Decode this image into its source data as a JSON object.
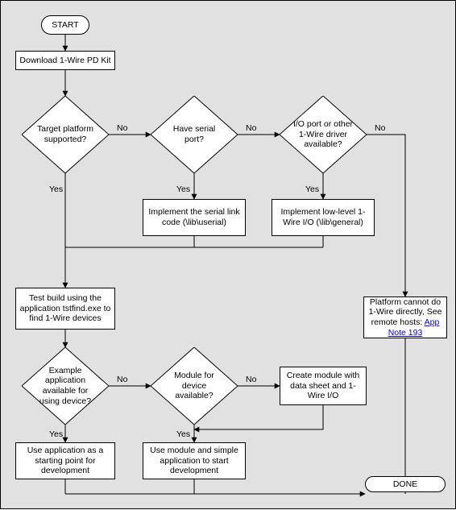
{
  "chart_data": {
    "type": "flowchart",
    "title": "",
    "nodes": [
      {
        "id": "start",
        "kind": "terminator",
        "text": "START"
      },
      {
        "id": "download",
        "kind": "process",
        "text": "Download 1-Wire PD Kit"
      },
      {
        "id": "d_target",
        "kind": "decision",
        "text": "Target platform supported?"
      },
      {
        "id": "d_serial",
        "kind": "decision",
        "text": "Have serial port?"
      },
      {
        "id": "d_ioport",
        "kind": "decision",
        "text": "I/O port or other 1-Wire driver available?"
      },
      {
        "id": "p_serial",
        "kind": "process",
        "text": "Implement the serial link code (\\lib\\userial)"
      },
      {
        "id": "p_lowlvl",
        "kind": "process",
        "text": "Implement low-level 1-Wire I/O (\\lib\\general)"
      },
      {
        "id": "p_test",
        "kind": "process",
        "text": "Test build using the application tstfind.exe to find 1-Wire devices"
      },
      {
        "id": "p_remote",
        "kind": "process",
        "text_before_link": "Platform cannot do 1-Wire directly, See remote hosts: ",
        "link_text": "App Note 193"
      },
      {
        "id": "d_example",
        "kind": "decision",
        "text": "Example application available for using device?"
      },
      {
        "id": "d_module",
        "kind": "decision",
        "text": "Module for device available?"
      },
      {
        "id": "p_create",
        "kind": "process",
        "text": "Create module with data sheet and 1-Wire I/O"
      },
      {
        "id": "p_useapp",
        "kind": "process",
        "text": "Use application as a starting point for development"
      },
      {
        "id": "p_usemod",
        "kind": "process",
        "text": "Use module and simple application to start development"
      },
      {
        "id": "done",
        "kind": "terminator",
        "text": "DONE"
      }
    ],
    "edges": [
      {
        "from": "start",
        "to": "download"
      },
      {
        "from": "download",
        "to": "d_target"
      },
      {
        "from": "d_target",
        "to": "d_serial",
        "label": "No"
      },
      {
        "from": "d_target",
        "to": "p_test",
        "label": "Yes"
      },
      {
        "from": "d_serial",
        "to": "d_ioport",
        "label": "No"
      },
      {
        "from": "d_serial",
        "to": "p_serial",
        "label": "Yes"
      },
      {
        "from": "d_ioport",
        "to": "p_remote",
        "label": "No"
      },
      {
        "from": "d_ioport",
        "to": "p_lowlvl",
        "label": "Yes"
      },
      {
        "from": "p_serial",
        "to": "p_test"
      },
      {
        "from": "p_lowlvl",
        "to": "p_test"
      },
      {
        "from": "p_test",
        "to": "d_example"
      },
      {
        "from": "d_example",
        "to": "d_module",
        "label": "No"
      },
      {
        "from": "d_example",
        "to": "p_useapp",
        "label": "Yes"
      },
      {
        "from": "d_module",
        "to": "p_create",
        "label": "No"
      },
      {
        "from": "d_module",
        "to": "p_usemod",
        "label": "Yes"
      },
      {
        "from": "p_create",
        "to": "p_usemod"
      },
      {
        "from": "p_useapp",
        "to": "done"
      },
      {
        "from": "p_usemod",
        "to": "done"
      },
      {
        "from": "p_remote",
        "to": "done"
      }
    ]
  },
  "labels": {
    "yes": "Yes",
    "no": "No"
  }
}
